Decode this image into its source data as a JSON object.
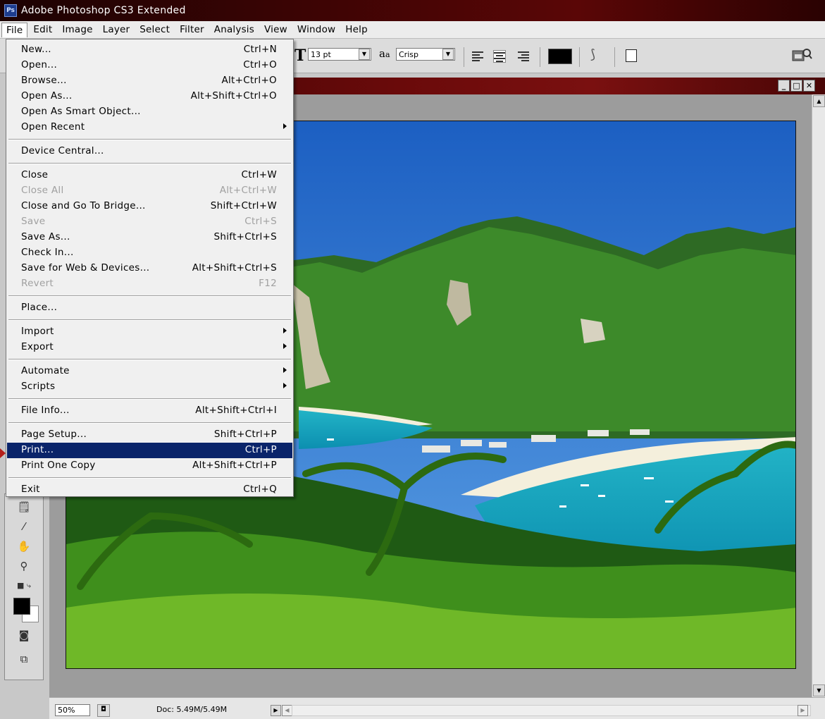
{
  "app": {
    "title": "Adobe Photoshop CS3 Extended",
    "logo_text": "Ps"
  },
  "menubar": [
    "File",
    "Edit",
    "Image",
    "Layer",
    "Select",
    "Filter",
    "Analysis",
    "View",
    "Window",
    "Help"
  ],
  "options": {
    "font_size": "13 pt",
    "antialias_label": "a",
    "antialias_sub": "a",
    "antialias_value": "Crisp",
    "color": "#000000"
  },
  "status": {
    "zoom": "50%",
    "doc_info": "Doc: 5.49M/5.49M"
  },
  "file_menu": [
    {
      "label": "New...",
      "shortcut": "Ctrl+N"
    },
    {
      "label": "Open...",
      "shortcut": "Ctrl+O"
    },
    {
      "label": "Browse...",
      "shortcut": "Alt+Ctrl+O"
    },
    {
      "label": "Open As...",
      "shortcut": "Alt+Shift+Ctrl+O"
    },
    {
      "label": "Open As Smart Object...",
      "shortcut": ""
    },
    {
      "label": "Open Recent",
      "shortcut": "",
      "submenu": true
    },
    {
      "sep": true
    },
    {
      "label": "Device Central...",
      "shortcut": ""
    },
    {
      "sep": true
    },
    {
      "label": "Close",
      "shortcut": "Ctrl+W"
    },
    {
      "label": "Close All",
      "shortcut": "Alt+Ctrl+W",
      "disabled": true
    },
    {
      "label": "Close and Go To Bridge...",
      "shortcut": "Shift+Ctrl+W"
    },
    {
      "label": "Save",
      "shortcut": "Ctrl+S",
      "disabled": true
    },
    {
      "label": "Save As...",
      "shortcut": "Shift+Ctrl+S"
    },
    {
      "label": "Check In...",
      "shortcut": ""
    },
    {
      "label": "Save for Web & Devices...",
      "shortcut": "Alt+Shift+Ctrl+S"
    },
    {
      "label": "Revert",
      "shortcut": "F12",
      "disabled": true
    },
    {
      "sep": true
    },
    {
      "label": "Place...",
      "shortcut": ""
    },
    {
      "sep": true
    },
    {
      "label": "Import",
      "shortcut": "",
      "submenu": true
    },
    {
      "label": "Export",
      "shortcut": "",
      "submenu": true
    },
    {
      "sep": true
    },
    {
      "label": "Automate",
      "shortcut": "",
      "submenu": true
    },
    {
      "label": "Scripts",
      "shortcut": "",
      "submenu": true
    },
    {
      "sep": true
    },
    {
      "label": "File Info...",
      "shortcut": "Alt+Shift+Ctrl+I"
    },
    {
      "sep": true
    },
    {
      "label": "Page Setup...",
      "shortcut": "Shift+Ctrl+P"
    },
    {
      "label": "Print...",
      "shortcut": "Ctrl+P",
      "highlight": true
    },
    {
      "label": "Print One Copy",
      "shortcut": "Alt+Shift+Ctrl+P"
    },
    {
      "sep": true
    },
    {
      "label": "Exit",
      "shortcut": "Ctrl+Q"
    }
  ],
  "colors": {
    "highlight": "#0a246a",
    "title_bar": "#5a0606"
  }
}
